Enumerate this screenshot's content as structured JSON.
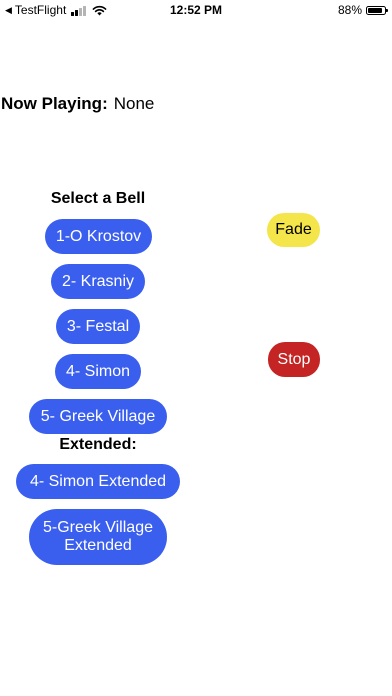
{
  "status_bar": {
    "back_app": "TestFlight",
    "time": "12:52 PM",
    "battery_percent": "88%",
    "battery_level": 0.88,
    "signal_bars_active": 2,
    "signal_bars_total": 4
  },
  "now_playing": {
    "label": "Now Playing:",
    "value": "None"
  },
  "bells": {
    "heading": "Select a Bell",
    "items": [
      {
        "label": "1-O Krostov"
      },
      {
        "label": "2- Krasniy"
      },
      {
        "label": "3- Festal"
      },
      {
        "label": "4- Simon"
      },
      {
        "label": "5- Greek Village"
      }
    ]
  },
  "extended": {
    "heading": "Extended:",
    "items": [
      {
        "label": "4- Simon Extended"
      },
      {
        "label": "5-Greek Village Extended"
      }
    ]
  },
  "controls": {
    "fade_label": "Fade",
    "stop_label": "Stop",
    "fade_color": "#f4e54a",
    "stop_color": "#c42424"
  },
  "colors": {
    "button_blue": "#3a5fef"
  }
}
